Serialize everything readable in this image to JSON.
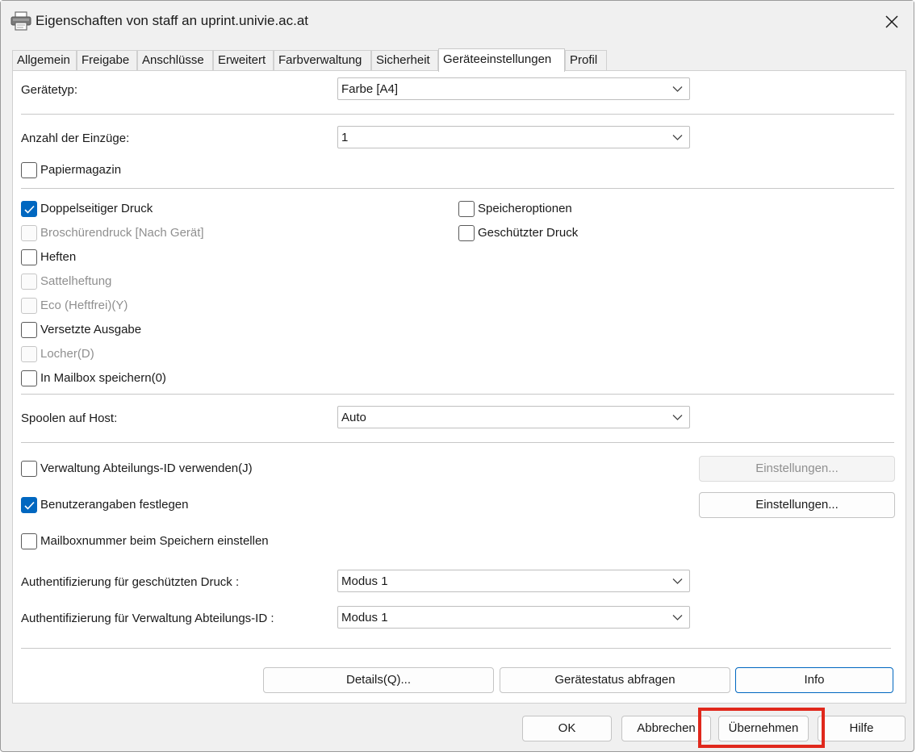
{
  "window": {
    "title": "Eigenschaften von staff an uprint.univie.ac.at",
    "app_icon": "printer-icon",
    "close_icon": "close-icon"
  },
  "tabs": [
    {
      "label": "Allgemein",
      "active": false
    },
    {
      "label": "Freigabe",
      "active": false
    },
    {
      "label": "Anschlüsse",
      "active": false
    },
    {
      "label": "Erweitert",
      "active": false
    },
    {
      "label": "Farbverwaltung",
      "active": false
    },
    {
      "label": "Sicherheit",
      "active": false
    },
    {
      "label": "Geräteeinstellungen",
      "active": true
    },
    {
      "label": "Profil",
      "active": false
    }
  ],
  "settings": {
    "device_type": {
      "label": "Gerätetyp:",
      "value": "Farbe [A4]"
    },
    "feed_count": {
      "label": "Anzahl der Einzüge:",
      "value": "1"
    },
    "paper_magazine": {
      "label": "Papiermagazin",
      "checked": false,
      "enabled": true
    },
    "options_left": [
      {
        "label": "Doppelseitiger Druck",
        "checked": true,
        "enabled": true
      },
      {
        "label": "Broschürendruck [Nach Gerät]",
        "checked": false,
        "enabled": false
      },
      {
        "label": "Heften",
        "checked": false,
        "enabled": true
      },
      {
        "label": "Sattelheftung",
        "checked": false,
        "enabled": false
      },
      {
        "label": "Eco (Heftfrei)(Y)",
        "checked": false,
        "enabled": false
      },
      {
        "label": "Versetzte Ausgabe",
        "checked": false,
        "enabled": true
      },
      {
        "label": "Locher(D)",
        "checked": false,
        "enabled": false
      },
      {
        "label": "In Mailbox speichern(0)",
        "checked": false,
        "enabled": true
      }
    ],
    "options_right": [
      {
        "label": "Speicheroptionen",
        "checked": false,
        "enabled": true
      },
      {
        "label": "Geschützter Druck",
        "checked": false,
        "enabled": true
      }
    ],
    "spool_on_host": {
      "label": "Spoolen auf Host:",
      "value": "Auto"
    },
    "department_id": {
      "label": "Verwaltung Abteilungs-ID verwenden(J)",
      "checked": false,
      "button": "Einstellungen...",
      "button_enabled": false
    },
    "user_info": {
      "label": "Benutzerangaben festlegen",
      "checked": true,
      "button": "Einstellungen...",
      "button_enabled": true
    },
    "mailbox_number": {
      "label": "Mailboxnummer beim Speichern einstellen",
      "checked": false
    },
    "auth_secure_print": {
      "label": "Authentifizierung für geschützten Druck :",
      "value": "Modus 1"
    },
    "auth_department": {
      "label": "Authentifizierung für Verwaltung Abteilungs-ID :",
      "value": "Modus 1"
    },
    "buttons": {
      "details": "Details(Q)...",
      "status": "Gerätestatus abfragen",
      "info": "Info"
    }
  },
  "footer": {
    "ok": "OK",
    "cancel": "Abbrechen",
    "apply": "Übernehmen",
    "help": "Hilfe"
  },
  "colors": {
    "accent": "#0067c0",
    "highlight": "#e0281c"
  }
}
